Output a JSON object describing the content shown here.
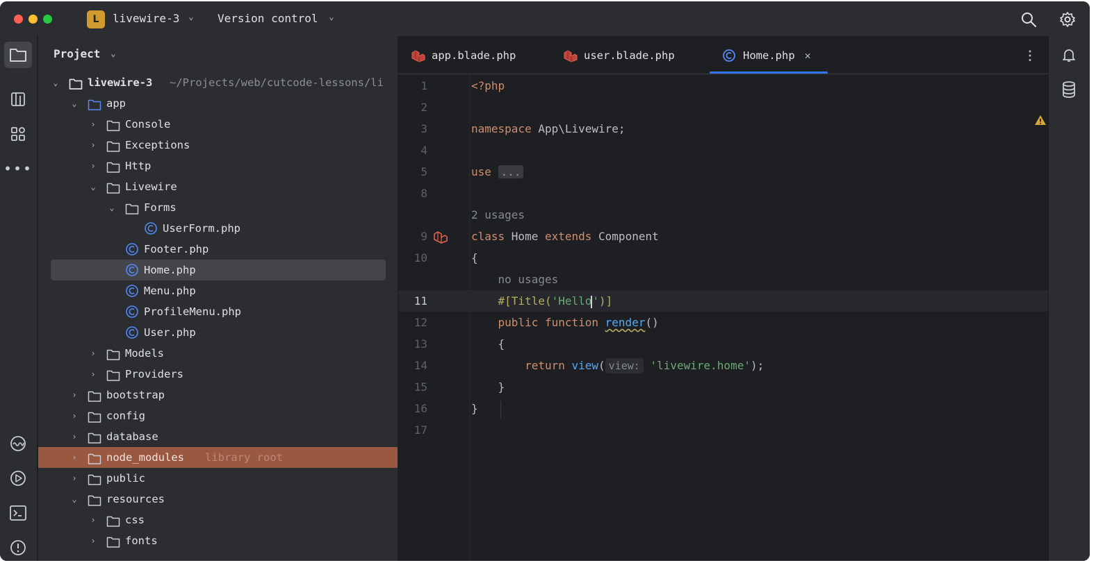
{
  "titlebar": {
    "project_badge": "L",
    "project_name": "livewire-3",
    "vcs_label": "Version control"
  },
  "project_panel": {
    "title": "Project",
    "tree": [
      {
        "depth": 0,
        "expanded": true,
        "type": "project",
        "label": "livewire-3",
        "path": "~/Projects/web/cutcode-lessons/li"
      },
      {
        "depth": 1,
        "expanded": true,
        "type": "folder-module",
        "label": "app"
      },
      {
        "depth": 2,
        "expanded": false,
        "type": "folder",
        "label": "Console"
      },
      {
        "depth": 2,
        "expanded": false,
        "type": "folder",
        "label": "Exceptions"
      },
      {
        "depth": 2,
        "expanded": false,
        "type": "folder",
        "label": "Http"
      },
      {
        "depth": 2,
        "expanded": true,
        "type": "folder",
        "label": "Livewire"
      },
      {
        "depth": 3,
        "expanded": true,
        "type": "folder",
        "label": "Forms"
      },
      {
        "depth": 4,
        "type": "php-class",
        "label": "UserForm.php"
      },
      {
        "depth": 3,
        "type": "php-class",
        "label": "Footer.php"
      },
      {
        "depth": 3,
        "type": "php-class",
        "label": "Home.php",
        "selected": true
      },
      {
        "depth": 3,
        "type": "php-class",
        "label": "Menu.php"
      },
      {
        "depth": 3,
        "type": "php-class",
        "label": "ProfileMenu.php"
      },
      {
        "depth": 3,
        "type": "php-class",
        "label": "User.php"
      },
      {
        "depth": 2,
        "expanded": false,
        "type": "folder",
        "label": "Models"
      },
      {
        "depth": 2,
        "expanded": false,
        "type": "folder",
        "label": "Providers"
      },
      {
        "depth": 1,
        "expanded": false,
        "type": "folder",
        "label": "bootstrap"
      },
      {
        "depth": 1,
        "expanded": false,
        "type": "folder",
        "label": "config"
      },
      {
        "depth": 1,
        "expanded": false,
        "type": "folder",
        "label": "database"
      },
      {
        "depth": 1,
        "expanded": false,
        "type": "folder",
        "label": "node_modules",
        "hint": "library root",
        "library_root": true
      },
      {
        "depth": 1,
        "expanded": false,
        "type": "folder",
        "label": "public"
      },
      {
        "depth": 1,
        "expanded": true,
        "type": "folder",
        "label": "resources"
      },
      {
        "depth": 2,
        "expanded": false,
        "type": "folder",
        "label": "css"
      },
      {
        "depth": 2,
        "expanded": false,
        "type": "folder",
        "label": "fonts"
      }
    ]
  },
  "editor": {
    "tabs": [
      {
        "label": "app.blade.php",
        "icon": "laravel-blade-icon",
        "active": false
      },
      {
        "label": "user.blade.php",
        "icon": "laravel-blade-icon",
        "active": false
      },
      {
        "label": "Home.php",
        "icon": "php-class-icon",
        "active": true,
        "closable": true
      }
    ],
    "lines": {
      "l1": {
        "num": "1",
        "tokens": [
          [
            "kw",
            "<?php"
          ]
        ]
      },
      "l2": {
        "num": "2",
        "tokens": []
      },
      "l3": {
        "num": "3",
        "tokens": [
          [
            "kw",
            "namespace "
          ],
          [
            "plain",
            "App\\Livewire;"
          ]
        ]
      },
      "l4": {
        "num": "4",
        "tokens": []
      },
      "l5": {
        "num": "5",
        "tokens": [
          [
            "kw",
            "use "
          ],
          [
            "fold",
            "..."
          ]
        ]
      },
      "l8": {
        "num": "8",
        "tokens": []
      },
      "usages1": {
        "num": "",
        "tokens": [
          [
            "hint-gray",
            "2 usages"
          ]
        ]
      },
      "l9": {
        "num": "9",
        "tokens": [
          [
            "kw",
            "class "
          ],
          [
            "plain",
            "Home "
          ],
          [
            "kw",
            "extends "
          ],
          [
            "plain",
            "Component"
          ]
        ]
      },
      "l10": {
        "num": "10",
        "tokens": [
          [
            "plain",
            "{"
          ]
        ]
      },
      "usages2": {
        "num": "",
        "tokens": [
          [
            "plain",
            "    "
          ],
          [
            "hint-gray",
            "no usages"
          ]
        ]
      },
      "l11": {
        "num": "11",
        "tokens": [
          [
            "plain",
            "    "
          ],
          [
            "attr",
            "#[Title("
          ],
          [
            "str",
            "'Hello"
          ],
          [
            "caret",
            ""
          ],
          [
            "str",
            "'"
          ],
          [
            "attr",
            ")]"
          ]
        ]
      },
      "l12": {
        "num": "12",
        "tokens": [
          [
            "plain",
            "    "
          ],
          [
            "kw",
            "public function "
          ],
          [
            "fn-squiggle",
            "render"
          ],
          [
            "plain",
            "()"
          ]
        ]
      },
      "l13": {
        "num": "13",
        "tokens": [
          [
            "plain",
            "    {"
          ]
        ]
      },
      "l14": {
        "num": "14",
        "tokens": [
          [
            "plain",
            "        "
          ],
          [
            "kw",
            "return "
          ],
          [
            "fn",
            "view"
          ],
          [
            "plain",
            "("
          ],
          [
            "inlay",
            "view:"
          ],
          [
            "plain",
            " "
          ],
          [
            "str",
            "'livewire.home'"
          ],
          [
            "plain",
            ");"
          ]
        ]
      },
      "l15": {
        "num": "15",
        "tokens": [
          [
            "plain",
            "    }"
          ]
        ]
      },
      "l16": {
        "num": "16",
        "tokens": [
          [
            "plain",
            "}"
          ]
        ]
      },
      "l17": {
        "num": "17",
        "tokens": []
      }
    }
  },
  "colors": {
    "accent": "#3574f0",
    "library_root_bg": "#9b5841",
    "keyword": "#cf8e6d",
    "string": "#6aab73",
    "function": "#56a8f5"
  }
}
